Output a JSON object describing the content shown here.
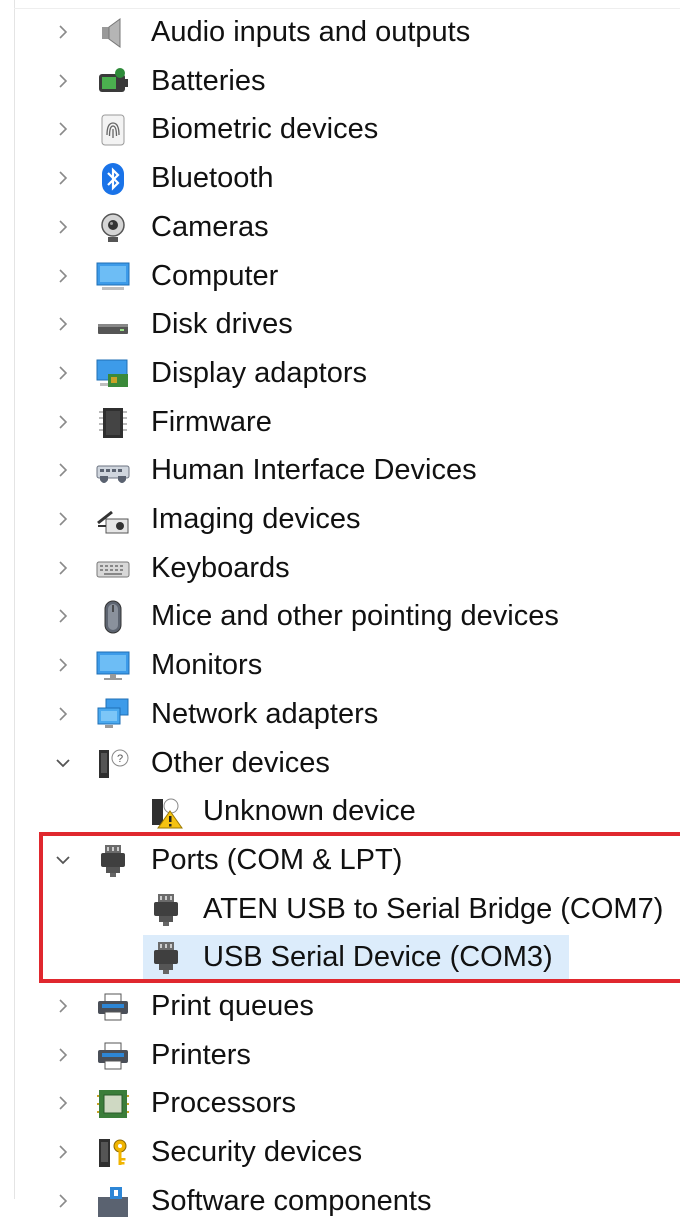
{
  "tree": {
    "nodes": [
      {
        "label": "Audio inputs and outputs",
        "icon": "speaker-icon",
        "expanded": false
      },
      {
        "label": "Batteries",
        "icon": "battery-icon",
        "expanded": false
      },
      {
        "label": "Biometric devices",
        "icon": "fingerprint-icon",
        "expanded": false
      },
      {
        "label": "Bluetooth",
        "icon": "bluetooth-icon",
        "expanded": false
      },
      {
        "label": "Cameras",
        "icon": "camera-icon",
        "expanded": false
      },
      {
        "label": "Computer",
        "icon": "computer-icon",
        "expanded": false
      },
      {
        "label": "Disk drives",
        "icon": "disk-drive-icon",
        "expanded": false
      },
      {
        "label": "Display adaptors",
        "icon": "display-adapter-icon",
        "expanded": false
      },
      {
        "label": "Firmware",
        "icon": "firmware-chip-icon",
        "expanded": false
      },
      {
        "label": "Human Interface Devices",
        "icon": "hid-icon",
        "expanded": false
      },
      {
        "label": "Imaging devices",
        "icon": "imaging-device-icon",
        "expanded": false
      },
      {
        "label": "Keyboards",
        "icon": "keyboard-icon",
        "expanded": false
      },
      {
        "label": "Mice and other pointing devices",
        "icon": "mouse-icon",
        "expanded": false
      },
      {
        "label": "Monitors",
        "icon": "monitor-icon",
        "expanded": false
      },
      {
        "label": "Network adapters",
        "icon": "network-adapter-icon",
        "expanded": false
      },
      {
        "label": "Other devices",
        "icon": "unknown-device-icon",
        "expanded": true
      },
      {
        "label": "Unknown device",
        "icon": "warning-device-icon",
        "child": true
      },
      {
        "label": "Ports (COM & LPT)",
        "icon": "port-icon",
        "expanded": true
      },
      {
        "label": "ATEN USB to Serial Bridge (COM7)",
        "icon": "port-icon",
        "child": true
      },
      {
        "label": "USB Serial Device (COM3)",
        "icon": "port-icon",
        "child": true,
        "selected": true
      },
      {
        "label": "Print queues",
        "icon": "printer-icon",
        "expanded": false
      },
      {
        "label": "Printers",
        "icon": "printer-icon",
        "expanded": false
      },
      {
        "label": "Processors",
        "icon": "processor-icon",
        "expanded": false
      },
      {
        "label": "Security devices",
        "icon": "security-key-icon",
        "expanded": false
      },
      {
        "label": "Software components",
        "icon": "software-component-icon",
        "expanded": false
      }
    ]
  },
  "colors": {
    "selection": "#dcecfb",
    "highlight_box": "#e0282e",
    "expander": "#777777"
  }
}
